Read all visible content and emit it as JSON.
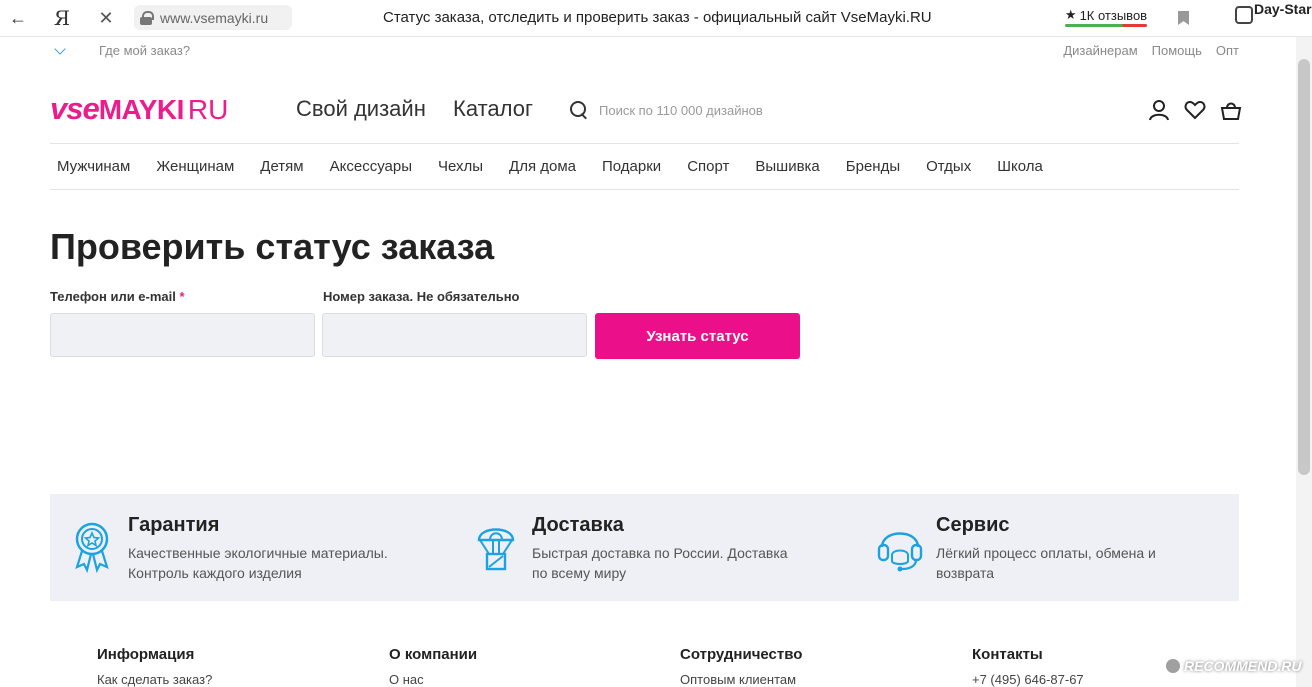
{
  "browser": {
    "url": "www.vsemayki.ru",
    "title": "Статус заказа, отследить и проверить заказ - официальный сайт VseMayki.RU",
    "yandex_glyph": "Я",
    "reviews": "1К отзывов",
    "extension_label": "Day-Star"
  },
  "topbar": {
    "where_order": "Где мой заказ?",
    "links": [
      "Дизайнерам",
      "Помощь",
      "Опт"
    ]
  },
  "header": {
    "logo_vse": "vse",
    "logo_mayki": "MAYKI",
    "logo_ru": "RU",
    "own_design": "Свой дизайн",
    "catalog": "Каталог",
    "search_placeholder": "Поиск по 110 000 дизайнов"
  },
  "categories": [
    "Мужчинам",
    "Женщинам",
    "Детям",
    "Аксессуары",
    "Чехлы",
    "Для дома",
    "Подарки",
    "Спорт",
    "Вышивка",
    "Бренды",
    "Отдых",
    "Школа"
  ],
  "form": {
    "title": "Проверить статус заказа",
    "phone_label": "Телефон или e-mail",
    "required_mark": "*",
    "order_label": "Номер заказа. Не обязательно",
    "phone_value": "",
    "order_value": "",
    "submit": "Узнать статус"
  },
  "benefits": [
    {
      "title": "Гарантия",
      "line1": "Качественные экологичные материалы.",
      "line2": "Контроль каждого изделия"
    },
    {
      "title": "Доставка",
      "line1": "Быстрая доставка по России. Доставка",
      "line2": "по всему миру"
    },
    {
      "title": "Сервис",
      "line1": "Лёгкий процесс оплаты, обмена и",
      "line2": "возврата"
    }
  ],
  "footer": {
    "columns": [
      {
        "heading": "Информация",
        "first_link": "Как сделать заказ?"
      },
      {
        "heading": "О компании",
        "first_link": "О нас"
      },
      {
        "heading": "Сотрудничество",
        "first_link": "Оптовым клиентам"
      },
      {
        "heading": "Контакты",
        "first_link": "+7 (495) 646-87-67"
      }
    ]
  },
  "watermark": "RECOMMEND.RU",
  "colors": {
    "brand_pink": "#ec1c8c",
    "button_pink": "#ec0f8a",
    "icon_blue": "#1aa3e0",
    "band_bg": "#eff0f5"
  }
}
